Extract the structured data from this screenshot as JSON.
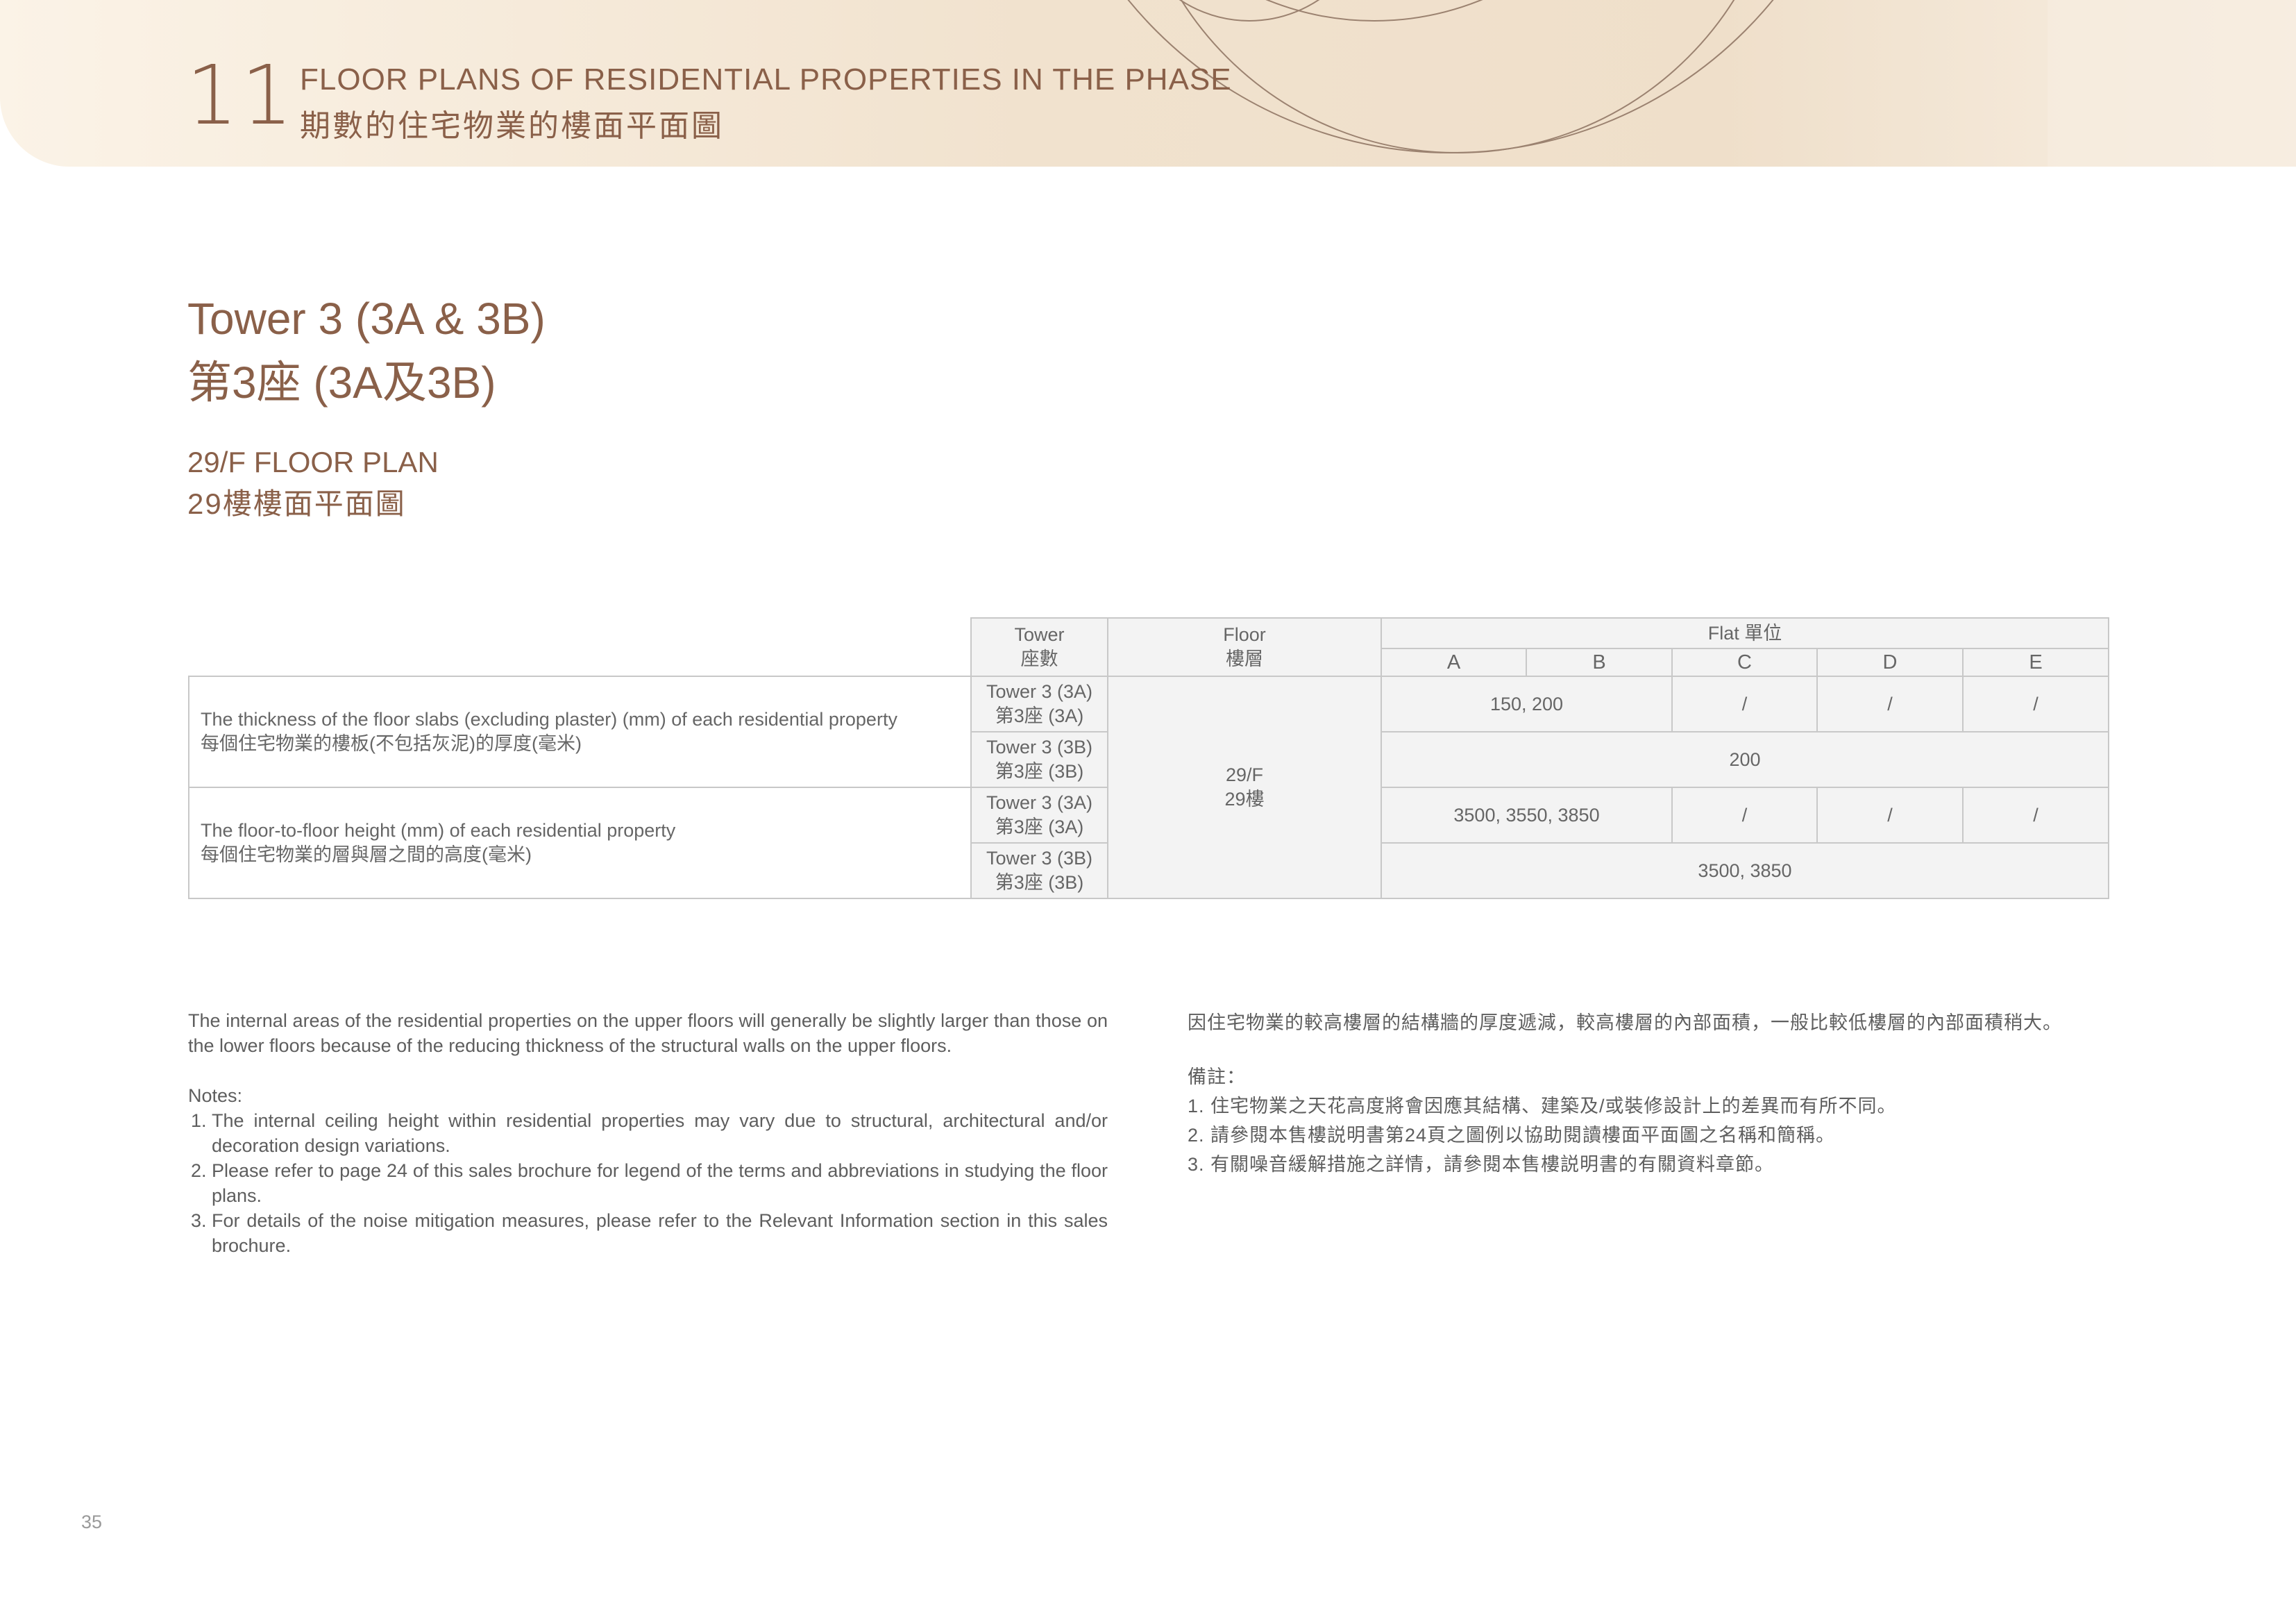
{
  "header": {
    "chapter_number": "11",
    "title_en": "FLOOR PLANS OF RESIDENTIAL PROPERTIES IN THE PHASE",
    "title_zh": "期數的住宅物業的樓面平面圖"
  },
  "tower": {
    "title_en": "Tower 3 (3A & 3B)",
    "title_zh": "第3座 (3A及3B)"
  },
  "plan": {
    "title_en": "29/F FLOOR PLAN",
    "title_zh": "29樓樓面平面圖"
  },
  "table": {
    "tower_header": [
      "Tower",
      "座數"
    ],
    "floor_header": [
      "Floor",
      "樓層"
    ],
    "flat_header": "Flat 單位",
    "flat_letters": [
      "A",
      "B",
      "C",
      "D",
      "E"
    ],
    "floor_value": [
      "29/F",
      "29樓"
    ],
    "rows": [
      {
        "label_en": "The thickness of the floor slabs (excluding plaster) (mm) of each residential property",
        "label_zh": "每個住宅物業的樓板(不包括灰泥)的厚度(毫米)",
        "tower_3a": [
          "Tower 3 (3A)",
          "第3座 (3A)"
        ],
        "tower_3a_values": {
          "ab": "150, 200",
          "c": "/",
          "d": "/",
          "e": "/"
        },
        "tower_3b": [
          "Tower 3 (3B)",
          "第3座 (3B)"
        ],
        "tower_3b_value": "200"
      },
      {
        "label_en": "The floor-to-floor height (mm) of each residential property",
        "label_zh": "每個住宅物業的層與層之間的高度(毫米)",
        "tower_3a": [
          "Tower 3 (3A)",
          "第3座 (3A)"
        ],
        "tower_3a_values": {
          "ab": "3500, 3550, 3850",
          "c": "/",
          "d": "/",
          "e": "/"
        },
        "tower_3b": [
          "Tower 3 (3B)",
          "第3座 (3B)"
        ],
        "tower_3b_value": "3500, 3850"
      }
    ]
  },
  "notes_en": {
    "intro": "The internal areas of the residential properties on the upper floors will generally be slightly larger than those on the lower floors because of the reducing thickness of the structural walls on the upper floors.",
    "heading": "Notes:",
    "items": [
      "The internal ceiling height within residential properties may vary due to structural, architectural and/or decoration design variations.",
      "Please refer to page 24 of this sales brochure for legend of the terms and abbreviations in studying the floor plans.",
      "For details of the noise mitigation measures, please refer to the Relevant Information section in this sales brochure."
    ]
  },
  "notes_zh": {
    "intro": "因住宅物業的較高樓層的結構牆的厚度遞減，較高樓層的內部面積，一般比較低樓層的內部面積稍大。",
    "heading": "備註：",
    "items": [
      "1. 住宅物業之天花高度將會因應其結構、建築及/或裝修設計上的差異而有所不同。",
      "2. 請參閱本售樓説明書第24頁之圖例以協助閱讀樓面平面圖之名稱和簡稱。",
      "3. 有關噪音緩解措施之詳情，請參閱本售樓説明書的有關資料章節。"
    ]
  },
  "page_number": "35",
  "colors": {
    "accent": "#8a6049",
    "header_band": "#f1e2ce",
    "table_shade": "#f3f3f3",
    "table_border": "#c8c8c8"
  }
}
